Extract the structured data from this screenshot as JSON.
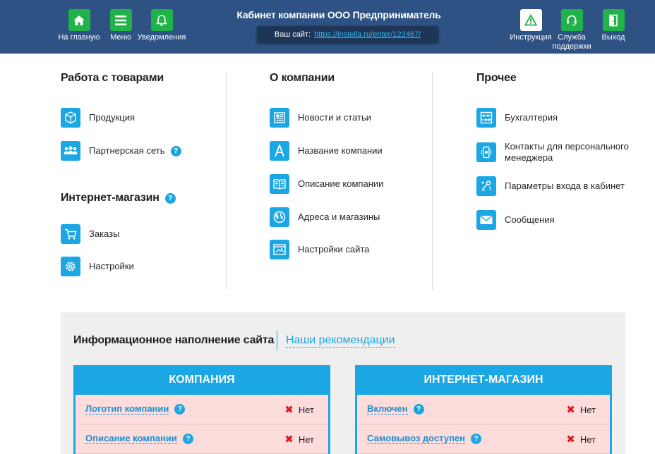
{
  "header": {
    "title": "Кабинет компании ООО Предприниматель",
    "site_label": "Ваш сайт:",
    "site_url": "https://instella.ru/enter/122467/",
    "buttons": {
      "home": "На главную",
      "menu": "Меню",
      "notifications": "Уведомления",
      "instruction": "Инструкция",
      "support": "Служба поддержки",
      "exit": "Выход"
    }
  },
  "columns": {
    "goods": {
      "title": "Работа с товарами",
      "items": [
        "Продукция",
        "Партнерская сеть"
      ]
    },
    "shop": {
      "title": "Интернет-магазин",
      "items": [
        "Заказы",
        "Настройки"
      ]
    },
    "company": {
      "title": "О компании",
      "items": [
        "Новости и статьи",
        "Название компании",
        "Описание компании",
        "Адреса и магазины",
        "Настройки сайта"
      ]
    },
    "other": {
      "title": "Прочее",
      "items": [
        "Бухгалтерия",
        "Контакты для персонального менеджера",
        "Параметры входа в кабинет",
        "Сообщения"
      ]
    }
  },
  "info": {
    "title": "Информационное наполнение сайта",
    "recommendations": "Наши рекомендации",
    "company_card": {
      "title": "КОМПАНИЯ",
      "rows": [
        {
          "label": "Логотип компании",
          "status": "Нет"
        },
        {
          "label": "Описание компании",
          "status": "Нет"
        }
      ]
    },
    "shop_card": {
      "title": "ИНТЕРНЕТ-МАГАЗИН",
      "rows": [
        {
          "label": "Включен",
          "status": "Нет"
        },
        {
          "label": "Самовывоз доступен",
          "status": "Нет"
        }
      ]
    }
  },
  "colors": {
    "header_bg": "#2d5283",
    "header_button": "#21b34a",
    "accent": "#1ba6e4",
    "row_error_bg": "#fddcdc",
    "status_x": "#e0191e"
  },
  "icons": {
    "home": "home-icon",
    "menu": "menu-icon",
    "notifications": "bell-icon",
    "instruction": "warning-icon",
    "support": "headset-icon",
    "exit": "exit-icon"
  }
}
